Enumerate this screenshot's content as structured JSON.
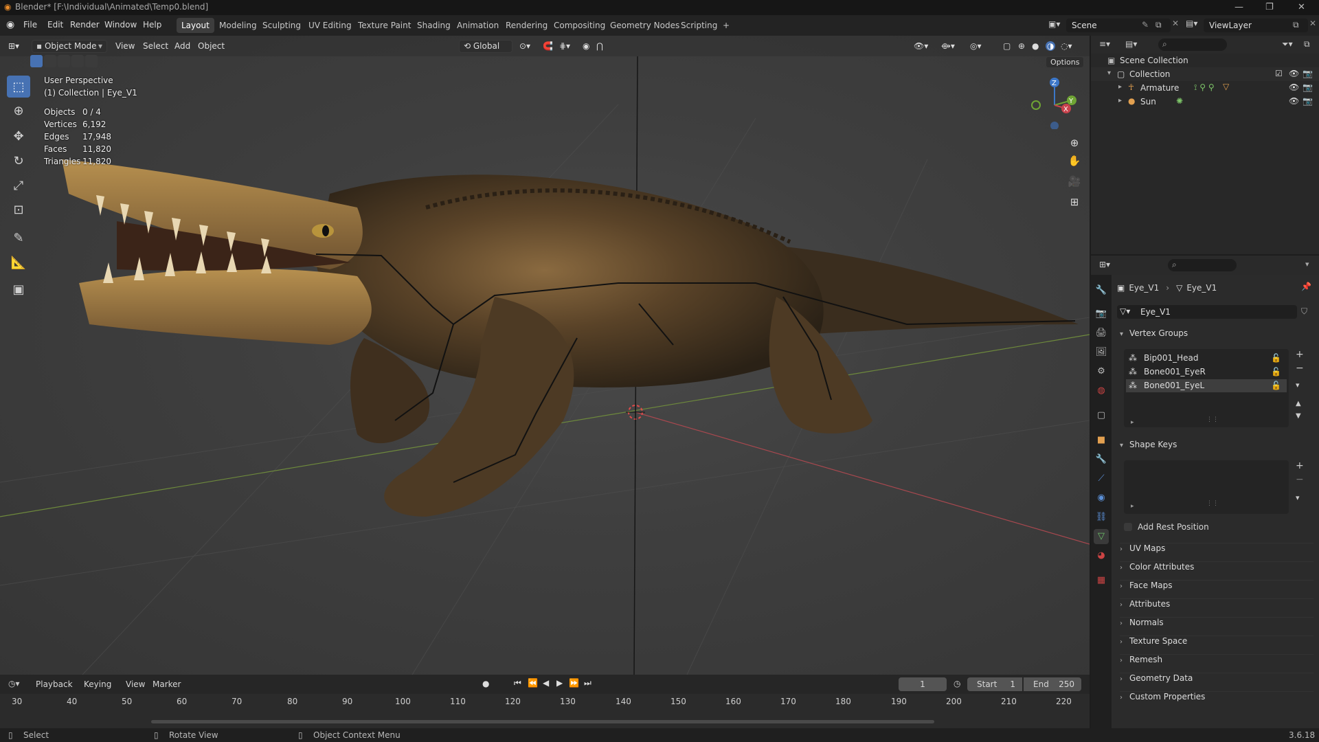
{
  "titlebar": {
    "title": "Blender* [F:\\Individual\\Animated\\Temp0.blend]",
    "controls": [
      "—",
      "❐",
      "✕"
    ]
  },
  "menu": [
    "File",
    "Edit",
    "Render",
    "Window",
    "Help"
  ],
  "workspaces": [
    "Layout",
    "Modeling",
    "Sculpting",
    "UV Editing",
    "Texture Paint",
    "Shading",
    "Animation",
    "Rendering",
    "Compositing",
    "Geometry Nodes",
    "Scripting",
    "+"
  ],
  "active_workspace": "Layout",
  "scene": {
    "scene_name": "Scene",
    "view_layer": "ViewLayer"
  },
  "viewport_header": {
    "mode": "Object Mode",
    "menus": [
      "View",
      "Select",
      "Add",
      "Object"
    ],
    "orientation": "Global",
    "options": "Options"
  },
  "overlay": {
    "perspective": "User Perspective",
    "collection_info": "(1) Collection | Eye_V1",
    "stats": [
      {
        "label": "Objects",
        "value": "0 / 4"
      },
      {
        "label": "Vertices",
        "value": "6,192"
      },
      {
        "label": "Edges",
        "value": "17,948"
      },
      {
        "label": "Faces",
        "value": "11,820"
      },
      {
        "label": "Triangles",
        "value": "11,820"
      }
    ]
  },
  "gizmo": {
    "x": "X",
    "y": "Y",
    "z": "Z"
  },
  "outliner": {
    "root": "Scene Collection",
    "collection": "Collection",
    "items": [
      "Armature",
      "Sun"
    ]
  },
  "properties": {
    "breadcrumb_object": "Eye_V1",
    "breadcrumb_mesh": "Eye_V1",
    "mesh_name": "Eye_V1",
    "vertex_groups_title": "Vertex Groups",
    "vertex_groups": [
      "Bip001_Head",
      "Bone001_EyeR",
      "Bone001_EyeL"
    ],
    "shape_keys_title": "Shape Keys",
    "add_rest_position": "Add Rest Position",
    "panels": [
      "UV Maps",
      "Color Attributes",
      "Face Maps",
      "Attributes",
      "Normals",
      "Texture Space",
      "Remesh",
      "Geometry Data",
      "Custom Properties"
    ]
  },
  "timeline": {
    "menus": [
      "Playback",
      "Keying",
      "View",
      "Marker"
    ],
    "current_frame": "1",
    "start_label": "Start",
    "start": "1",
    "end_label": "End",
    "end": "250",
    "ticks": [
      "30",
      "40",
      "50",
      "60",
      "70",
      "80",
      "90",
      "100",
      "110",
      "120",
      "130",
      "140",
      "150",
      "160",
      "170",
      "180",
      "190",
      "200",
      "210",
      "220"
    ]
  },
  "statusbar": {
    "select": "Select",
    "rotate": "Rotate View",
    "context": "Object Context Menu",
    "version": "3.6.18"
  },
  "colors": {
    "accent": "#4772b3",
    "x_axis": "#c8424c",
    "y_axis": "#6fa434",
    "z_axis": "#3c77c9"
  }
}
